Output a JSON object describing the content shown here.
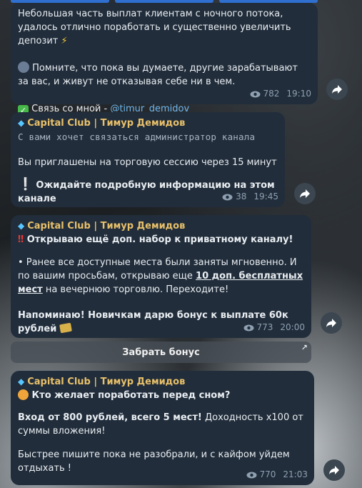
{
  "msg1": {
    "line1": "Небольшая часть выплат клиентам с ночного потока, удалось отлично поработать и существенно увеличить депозит",
    "line1_emoji": "⚡",
    "line2": "Помните, что пока вы думаете, другие зарабатывают за вас, и живут не отказывая себе ни в чем.",
    "contact_prefix": "Связь со мной - ",
    "contact_link": "@timur_demidov",
    "views": "782",
    "time": "19:10"
  },
  "msg2": {
    "channel": "Capital Club | Тимур Демидов",
    "mono": "С вами хочет связаться администратор канала",
    "text": "Вы приглашены на торговую сессию через 15 минут",
    "bold_text": "Ожидайте подробную информацию на этом канале",
    "views": "38",
    "time": "19:45"
  },
  "msg3": {
    "channel": "Capital Club | Тимур Демидов",
    "headline": "Открываю ещё доп. набор к приватному каналу!",
    "para_a": "• Ранее все доступные места были заняты мгновенно. И по вашим просьбам, открываю еще ",
    "para_underline": "10 доп. бесплатных мест",
    "para_b": " на вечернюю торговлю. Переходите!",
    "reminder": "Напоминаю! Новичкам дарю бонус к выплате 60к рублей",
    "views": "773",
    "time": "20:00",
    "button": "Забрать бонус"
  },
  "msg4": {
    "channel": "Capital Club | Тимур Демидов",
    "headline": "Кто желает поработать перед сном?",
    "entry_bold": "Вход от 800 рублей, всего 5 мест!",
    "entry_rest": " Доходность х100 от суммы вложения!",
    "hurry": "Быстрее пишите пока не разобрали, и с кайфом уйдем отдыхать !",
    "views": "770",
    "time": "21:03"
  },
  "colors": {
    "bubble": "#212d3b",
    "channel_name": "#e8c06a",
    "link": "#6fb8f2"
  },
  "icons": {
    "forward": "forward-arrow-icon",
    "views": "eye-icon",
    "diamond": "diamond-icon"
  }
}
